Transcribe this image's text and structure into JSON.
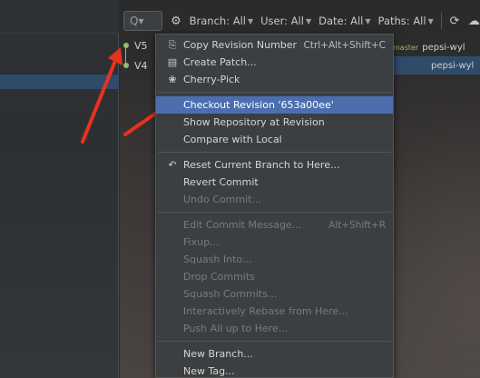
{
  "toolbar": {
    "search_placeholder": "Q▾",
    "filters": [
      {
        "label": "Branch: All"
      },
      {
        "label": "User: All"
      },
      {
        "label": "Date: All"
      },
      {
        "label": "Paths: All"
      }
    ]
  },
  "commits": [
    {
      "label": "V5",
      "author": "pepsi-wyl",
      "tag": "master"
    },
    {
      "label": "V4",
      "author": "pepsi-wyl",
      "tag": ""
    }
  ],
  "menu": {
    "groups": [
      [
        {
          "label": "Copy Revision Number",
          "shortcut": "Ctrl+Alt+Shift+C",
          "icon": "copy-icon",
          "glyph": "⎘",
          "enabled": true
        },
        {
          "label": "Create Patch...",
          "shortcut": "",
          "icon": "patch-icon",
          "glyph": "▤",
          "enabled": true
        },
        {
          "label": "Cherry-Pick",
          "shortcut": "",
          "icon": "cherry-icon",
          "glyph": "❀",
          "enabled": true
        }
      ],
      [
        {
          "label": "Checkout Revision '653a00ee'",
          "shortcut": "",
          "icon": "",
          "glyph": "",
          "enabled": true,
          "selected": true
        },
        {
          "label": "Show Repository at Revision",
          "shortcut": "",
          "icon": "",
          "glyph": "",
          "enabled": true
        },
        {
          "label": "Compare with Local",
          "shortcut": "",
          "icon": "",
          "glyph": "",
          "enabled": true
        }
      ],
      [
        {
          "label": "Reset Current Branch to Here...",
          "shortcut": "",
          "icon": "undo-icon",
          "glyph": "↶",
          "enabled": true
        },
        {
          "label": "Revert Commit",
          "shortcut": "",
          "icon": "",
          "glyph": "",
          "enabled": true
        },
        {
          "label": "Undo Commit...",
          "shortcut": "",
          "icon": "",
          "glyph": "",
          "enabled": false
        }
      ],
      [
        {
          "label": "Edit Commit Message...",
          "shortcut": "Alt+Shift+R",
          "icon": "",
          "glyph": "",
          "enabled": false
        },
        {
          "label": "Fixup...",
          "shortcut": "",
          "icon": "",
          "glyph": "",
          "enabled": false
        },
        {
          "label": "Squash Into...",
          "shortcut": "",
          "icon": "",
          "glyph": "",
          "enabled": false
        },
        {
          "label": "Drop Commits",
          "shortcut": "",
          "icon": "",
          "glyph": "",
          "enabled": false
        },
        {
          "label": "Squash Commits...",
          "shortcut": "",
          "icon": "",
          "glyph": "",
          "enabled": false
        },
        {
          "label": "Interactively Rebase from Here...",
          "shortcut": "",
          "icon": "",
          "glyph": "",
          "enabled": false
        },
        {
          "label": "Push All up to Here...",
          "shortcut": "",
          "icon": "",
          "glyph": "",
          "enabled": false
        }
      ],
      [
        {
          "label": "New Branch...",
          "shortcut": "",
          "icon": "",
          "glyph": "",
          "enabled": true
        },
        {
          "label": "New Tag...",
          "shortcut": "",
          "icon": "",
          "glyph": "",
          "enabled": true
        }
      ]
    ]
  }
}
